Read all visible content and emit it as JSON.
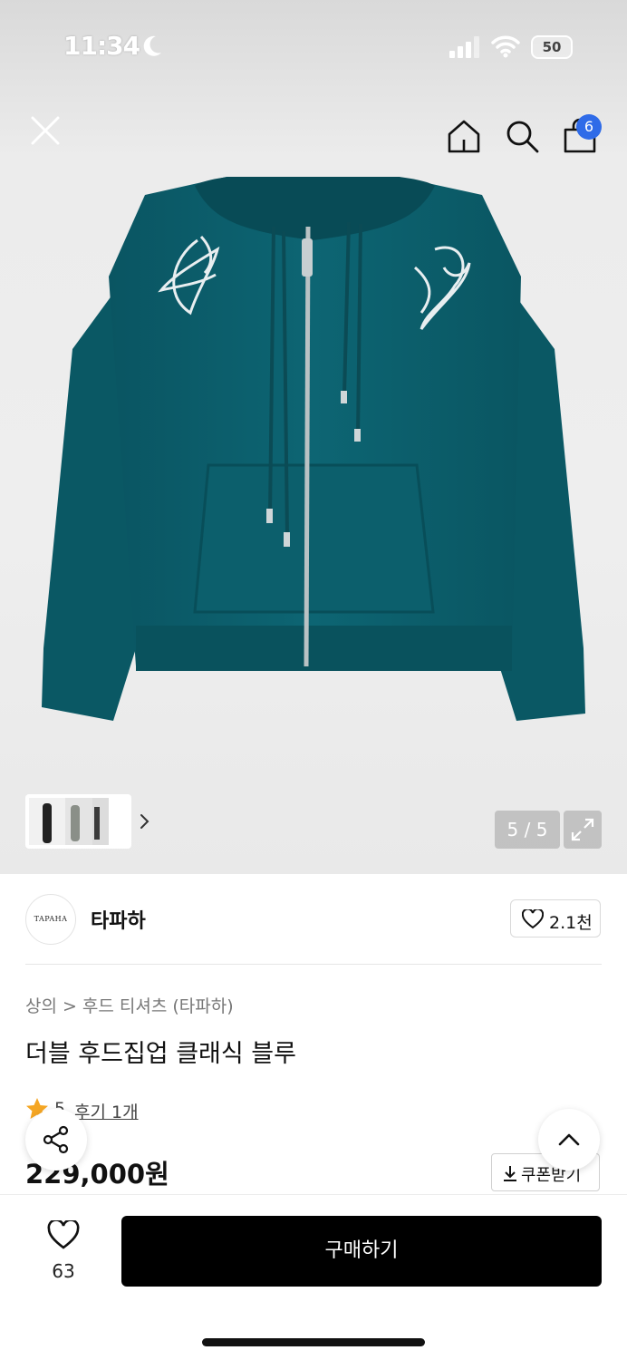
{
  "status_bar": {
    "time": "11:34",
    "battery": "50"
  },
  "header": {
    "cart_badge": "6"
  },
  "gallery": {
    "page_counter": "5 / 5"
  },
  "brand": {
    "logo_text": "TAPAHA",
    "name": "타파하",
    "like_count": "2.1천"
  },
  "breadcrumb": {
    "category": "상의",
    "separator": ">",
    "subcategory": "후드 티셔츠 (타파하)"
  },
  "product": {
    "title": "더블 후드집업 클래식 블루",
    "rating": "5",
    "review_link": "후기 1개",
    "price": "229,000원",
    "coupon_label": "쿠폰받기"
  },
  "bottom_bar": {
    "wish_count": "63",
    "buy_label": "구매하기"
  },
  "colors": {
    "hoodie": "#0b5f6c",
    "badge": "#2f6be8",
    "star": "#f5a623",
    "buy_button": "#000000"
  },
  "icons": [
    "close-icon",
    "home-icon",
    "search-icon",
    "shopping-bag-icon",
    "chevron-right-icon",
    "expand-icon",
    "heart-icon",
    "share-icon",
    "chevron-up-icon",
    "download-icon",
    "star-icon"
  ]
}
